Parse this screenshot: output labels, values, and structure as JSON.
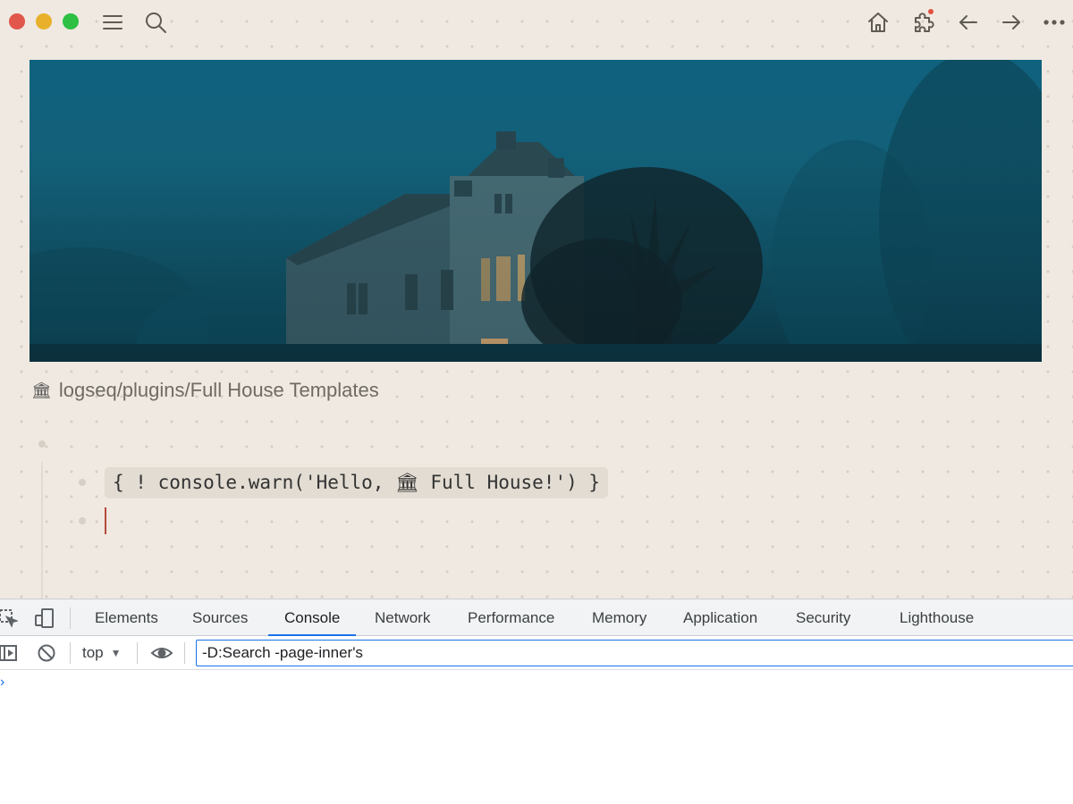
{
  "window": {
    "traffic_lights": [
      "close",
      "minimize",
      "maximize"
    ]
  },
  "toolbar": {
    "left_icons": [
      "menu-icon",
      "search-icon"
    ],
    "right_icons": [
      "home-icon",
      "puzzle-icon",
      "arrow-left-icon",
      "arrow-right-icon",
      "more-icon"
    ]
  },
  "page": {
    "icon": "🏛",
    "title": "logseq/plugins/Full House Templates"
  },
  "blocks": [
    {
      "content": "{ ! console.warn('Hello, 🏛 Full House!') }"
    },
    {
      "content": ""
    }
  ],
  "devtools": {
    "tabs": [
      "Elements",
      "Sources",
      "Console",
      "Network",
      "Performance",
      "Memory",
      "Application",
      "Security",
      "Lighthouse"
    ],
    "active_tab": "Console",
    "context": "top",
    "filter_value": "-D:Search -page-inner's",
    "prompt_symbol": "›"
  },
  "colors": {
    "accent": "#1a73e8",
    "background": "#efe9e1",
    "traffic_red": "#e2574c",
    "traffic_yellow": "#e9b12b",
    "traffic_green": "#2dc042"
  }
}
